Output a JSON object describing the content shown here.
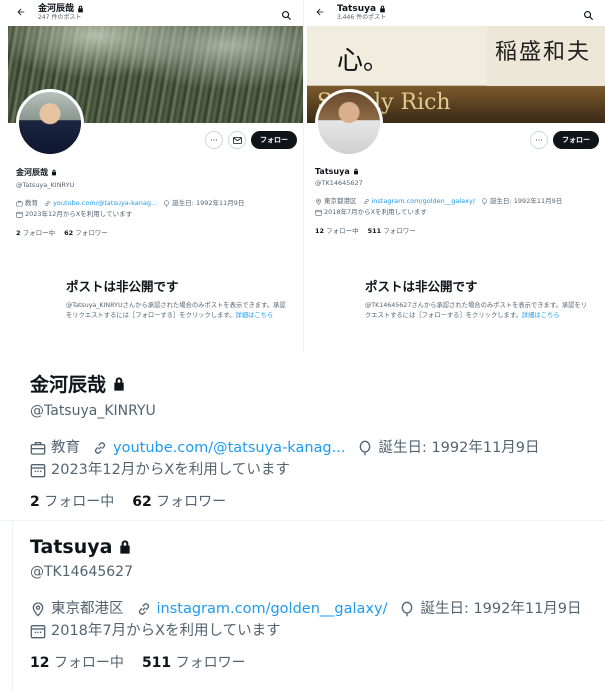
{
  "left_panel": {
    "name": "金河辰哉",
    "post_count": "247 件のポスト",
    "handle": "@Tatsuya_KINRYU",
    "category": "教育",
    "link": "youtube.com/@tatsuya-kanag...",
    "birthday": "誕生日: 1992年11月9日",
    "joined": "2023年12月からXを利用しています",
    "following_count": "2",
    "following_label": "フォロー中",
    "followers_count": "62",
    "followers_label": "フォロワー",
    "follow_button": "フォロー",
    "private_title": "ポストは非公開です",
    "private_body": "@Tatsuya_KINRYUさんから承認された場合のみポストを表示できます。承認をリクエストするには［フォローする］をクリックします。",
    "private_link": "詳細はこちら"
  },
  "right_panel": {
    "name": "Tatsuya",
    "post_count": "3,446 件のポスト",
    "handle": "@TK14645627",
    "location": "東京都港区",
    "link": "instagram.com/golden__galaxy/",
    "birthday": "誕生日: 1992年11月9日",
    "joined": "2018年7月からXを利用しています",
    "following_count": "12",
    "following_label": "フォロー中",
    "followers_count": "511",
    "followers_label": "フォロワー",
    "follow_button": "フォロー",
    "private_title": "ポストは非公開です",
    "private_body": "@TK14645627さんから承認された場合のみポストを表示できます。承認をリクエストするには［フォローする］をクリックします。",
    "private_link": "詳細はこちら",
    "banner_text_1": "心。",
    "banner_text_2": "稲盛和夫",
    "banner_text_3": "Simply Rich"
  },
  "zoom_left": {
    "name": "金河辰哉",
    "handle": "@Tatsuya_KINRYU",
    "category": "教育",
    "link": "youtube.com/@tatsuya-kanag...",
    "birthday": "誕生日: 1992年11月9日",
    "joined": "2023年12月からXを利用しています",
    "following_count": "2",
    "following_label": "フォロー中",
    "followers_count": "62",
    "followers_label": "フォロワー"
  },
  "zoom_right": {
    "name": "Tatsuya",
    "handle": "@TK14645627",
    "location": "東京都港区",
    "link": "instagram.com/golden__galaxy/",
    "birthday": "誕生日: 1992年11月9日",
    "joined": "2018年7月からXを利用しています",
    "following_count": "12",
    "following_label": "フォロー中",
    "followers_count": "511",
    "followers_label": "フォロワー"
  },
  "colors": {
    "link": "#1d9bf0",
    "text_primary": "#0f1419",
    "text_secondary": "#536471",
    "follow_button_bg": "#0f1419"
  },
  "icons": [
    "back-arrow-icon",
    "lock-icon",
    "search-icon",
    "more-icon",
    "mail-icon",
    "briefcase-icon",
    "link-icon",
    "location-icon",
    "balloon-icon",
    "calendar-icon"
  ]
}
